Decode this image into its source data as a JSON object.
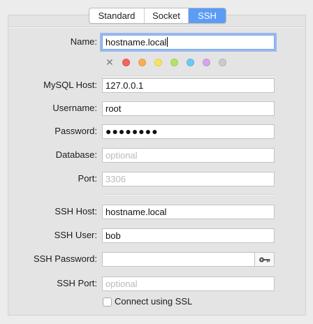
{
  "tabs": [
    {
      "label": "Standard",
      "active": false
    },
    {
      "label": "Socket",
      "active": false
    },
    {
      "label": "SSH",
      "active": true
    }
  ],
  "form": {
    "name": {
      "label": "Name:",
      "value": "hostname.local"
    },
    "colors": {
      "clear_icon": "x-mark-icon",
      "swatches": [
        {
          "name": "red",
          "fill": "#f2665d",
          "stroke": "#e0544b"
        },
        {
          "name": "orange",
          "fill": "#f7ad5a",
          "stroke": "#e59a48"
        },
        {
          "name": "yellow",
          "fill": "#f7e35e",
          "stroke": "#e2ce4c"
        },
        {
          "name": "green",
          "fill": "#b3e36b",
          "stroke": "#9fcf58"
        },
        {
          "name": "blue",
          "fill": "#6ec8f7",
          "stroke": "#5ab4e3"
        },
        {
          "name": "purple",
          "fill": "#d7a5ec",
          "stroke": "#c392d8"
        },
        {
          "name": "gray",
          "fill": "#cbcbcb",
          "stroke": "#b3b3b3"
        }
      ]
    },
    "mysql_host": {
      "label": "MySQL Host:",
      "value": "127.0.0.1"
    },
    "username": {
      "label": "Username:",
      "value": "root"
    },
    "password": {
      "label": "Password:",
      "value": "●●●●●●●●"
    },
    "database": {
      "label": "Database:",
      "placeholder": "optional"
    },
    "port": {
      "label": "Port:",
      "placeholder": "3306"
    },
    "ssh_host": {
      "label": "SSH Host:",
      "value": "hostname.local"
    },
    "ssh_user": {
      "label": "SSH User:",
      "value": "bob"
    },
    "ssh_password": {
      "label": "SSH Password:",
      "value": "",
      "key_icon": "key-icon"
    },
    "ssh_port": {
      "label": "SSH Port:",
      "placeholder": "optional"
    },
    "ssl": {
      "label": "Connect using SSL",
      "checked": false
    }
  }
}
